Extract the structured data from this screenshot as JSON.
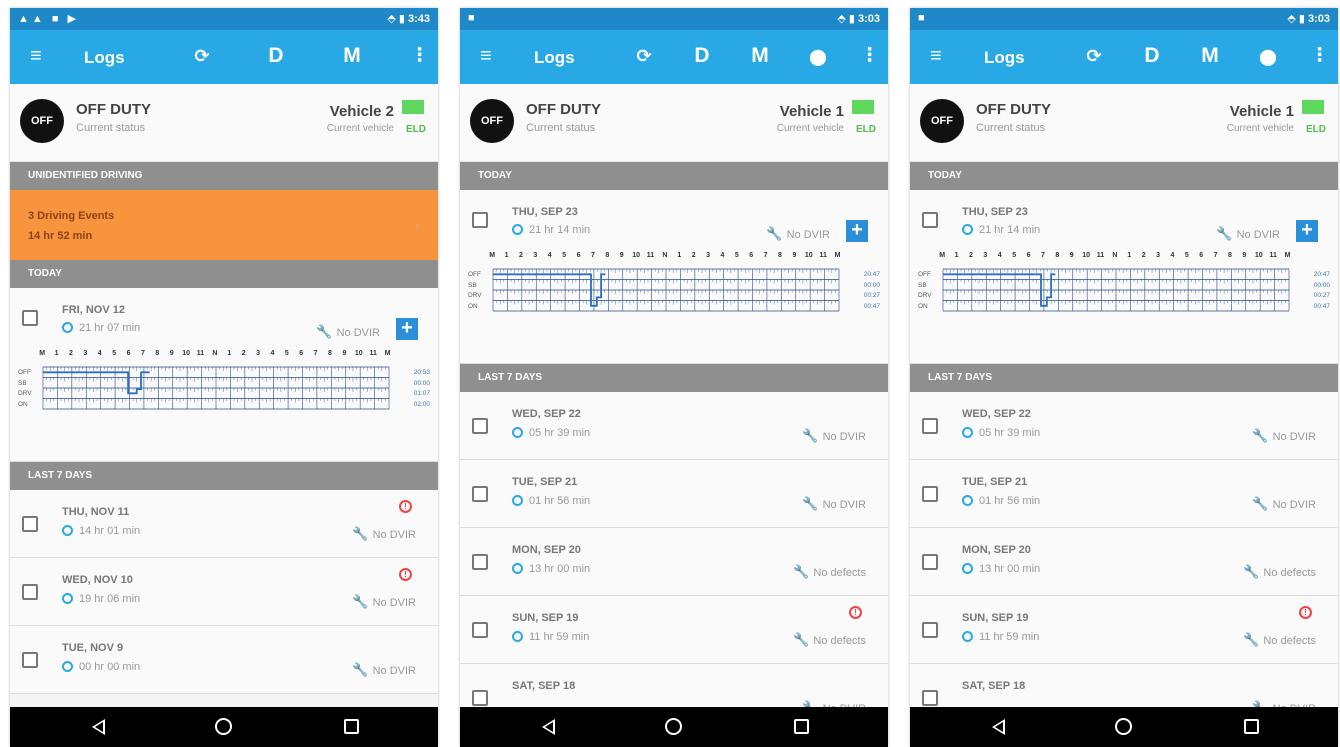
{
  "screens": [
    {
      "status_bar": {
        "left": "▲▲ ■ ▶",
        "right": "⬘ ▮ 3:43"
      },
      "app_bar": {
        "title": "Logs",
        "sync_icon": "sync-icon",
        "d_label": "D",
        "m_label": "M",
        "show_location": false
      },
      "current": {
        "badge": "OFF",
        "status": "OFF DUTY",
        "status_sub": "Current status",
        "vehicle": "Vehicle 2",
        "vehicle_sub": "Current vehicle",
        "eld": "ELD"
      },
      "unidentified": {
        "header": "UNIDENTIFIED DRIVING",
        "events": "3 Driving Events",
        "duration": "14 hr 52 min"
      },
      "today": {
        "header": "TODAY",
        "date": "FRI, NOV 12",
        "hours": "21 hr 07 min",
        "dvir": "No DVIR"
      },
      "grid": {
        "hours": [
          "M",
          "1",
          "2",
          "3",
          "4",
          "5",
          "6",
          "7",
          "8",
          "9",
          "10",
          "11",
          "N",
          "1",
          "2",
          "3",
          "4",
          "5",
          "6",
          "7",
          "8",
          "9",
          "10",
          "11",
          "M"
        ],
        "duty_labels": [
          "OFF",
          "SB",
          "DRV",
          "ON"
        ],
        "totals": [
          "20:53",
          "00:00",
          "01:07",
          "02:00"
        ]
      },
      "last7_header": "LAST 7 DAYS",
      "days": [
        {
          "date": "THU, NOV 11",
          "hours": "14 hr 01 min",
          "dvir": "No DVIR",
          "warn": true
        },
        {
          "date": "WED, NOV 10",
          "hours": "19 hr 06 min",
          "dvir": "No DVIR",
          "warn": true
        },
        {
          "date": "TUE, NOV 9",
          "hours": "00 hr 00 min",
          "dvir": "No DVIR",
          "warn": false
        }
      ]
    },
    {
      "status_bar": {
        "left": "■",
        "right": "⬘ ▮ 3:03"
      },
      "app_bar": {
        "title": "Logs",
        "sync_icon": "sync-icon",
        "d_label": "D",
        "m_label": "M",
        "show_location": true
      },
      "current": {
        "badge": "OFF",
        "status": "OFF DUTY",
        "status_sub": "Current status",
        "vehicle": "Vehicle 1",
        "vehicle_sub": "Current vehicle",
        "eld": "ELD"
      },
      "today": {
        "header": "TODAY",
        "date": "THU, SEP 23",
        "hours": "21 hr 14 min",
        "dvir": "No DVIR"
      },
      "grid": {
        "hours": [
          "M",
          "1",
          "2",
          "3",
          "4",
          "5",
          "6",
          "7",
          "8",
          "9",
          "10",
          "11",
          "N",
          "1",
          "2",
          "3",
          "4",
          "5",
          "6",
          "7",
          "8",
          "9",
          "10",
          "11",
          "M"
        ],
        "duty_labels": [
          "OFF",
          "SB",
          "DRV",
          "ON"
        ],
        "totals": [
          "20:47",
          "00:00",
          "00:27",
          "00:47"
        ]
      },
      "last7_header": "LAST 7 DAYS",
      "days": [
        {
          "date": "WED, SEP 22",
          "hours": "05 hr 39 min",
          "dvir": "No DVIR",
          "warn": false
        },
        {
          "date": "TUE, SEP 21",
          "hours": "01 hr 56 min",
          "dvir": "No DVIR",
          "warn": false
        },
        {
          "date": "MON, SEP 20",
          "hours": "13 hr 00 min",
          "dvir": "No defects",
          "warn": false
        },
        {
          "date": "SUN, SEP 19",
          "hours": "11 hr 59 min",
          "dvir": "No defects",
          "warn": true
        },
        {
          "date": "SAT, SEP 18",
          "hours": "",
          "dvir": "No DVIR",
          "warn": false
        }
      ]
    },
    {
      "status_bar": {
        "left": "■",
        "right": "⬘ ▮ 3:03"
      },
      "app_bar": {
        "title": "Logs",
        "sync_icon": "sync-icon",
        "d_label": "D",
        "m_label": "M",
        "show_location": true
      },
      "current": {
        "badge": "OFF",
        "status": "OFF DUTY",
        "status_sub": "Current status",
        "vehicle": "Vehicle 1",
        "vehicle_sub": "Current vehicle",
        "eld": "ELD"
      },
      "today": {
        "header": "TODAY",
        "date": "THU, SEP 23",
        "hours": "21 hr 14 min",
        "dvir": "No DVIR"
      },
      "grid": {
        "hours": [
          "M",
          "1",
          "2",
          "3",
          "4",
          "5",
          "6",
          "7",
          "8",
          "9",
          "10",
          "11",
          "N",
          "1",
          "2",
          "3",
          "4",
          "5",
          "6",
          "7",
          "8",
          "9",
          "10",
          "11",
          "M"
        ],
        "duty_labels": [
          "OFF",
          "SB",
          "DRV",
          "ON"
        ],
        "totals": [
          "20:47",
          "00:00",
          "00:27",
          "00:47"
        ]
      },
      "last7_header": "LAST 7 DAYS",
      "days": [
        {
          "date": "WED, SEP 22",
          "hours": "05 hr 39 min",
          "dvir": "No DVIR",
          "warn": false
        },
        {
          "date": "TUE, SEP 21",
          "hours": "01 hr 56 min",
          "dvir": "No DVIR",
          "warn": false
        },
        {
          "date": "MON, SEP 20",
          "hours": "13 hr 00 min",
          "dvir": "No defects",
          "warn": false
        },
        {
          "date": "SUN, SEP 19",
          "hours": "11 hr 59 min",
          "dvir": "No defects",
          "warn": true
        },
        {
          "date": "SAT, SEP 18",
          "hours": "",
          "dvir": "No DVIR",
          "warn": false
        }
      ]
    }
  ],
  "colors": {
    "status_bar": "#1e88c8",
    "app_bar": "#29a8e6",
    "section_header": "#8f8f8f",
    "unidentified": "#f7943d",
    "eld_badge": "#5fd75f",
    "grid_line": "#2a4a8a",
    "grid_trace": "#2a6fc4",
    "warning": "#e44444"
  }
}
